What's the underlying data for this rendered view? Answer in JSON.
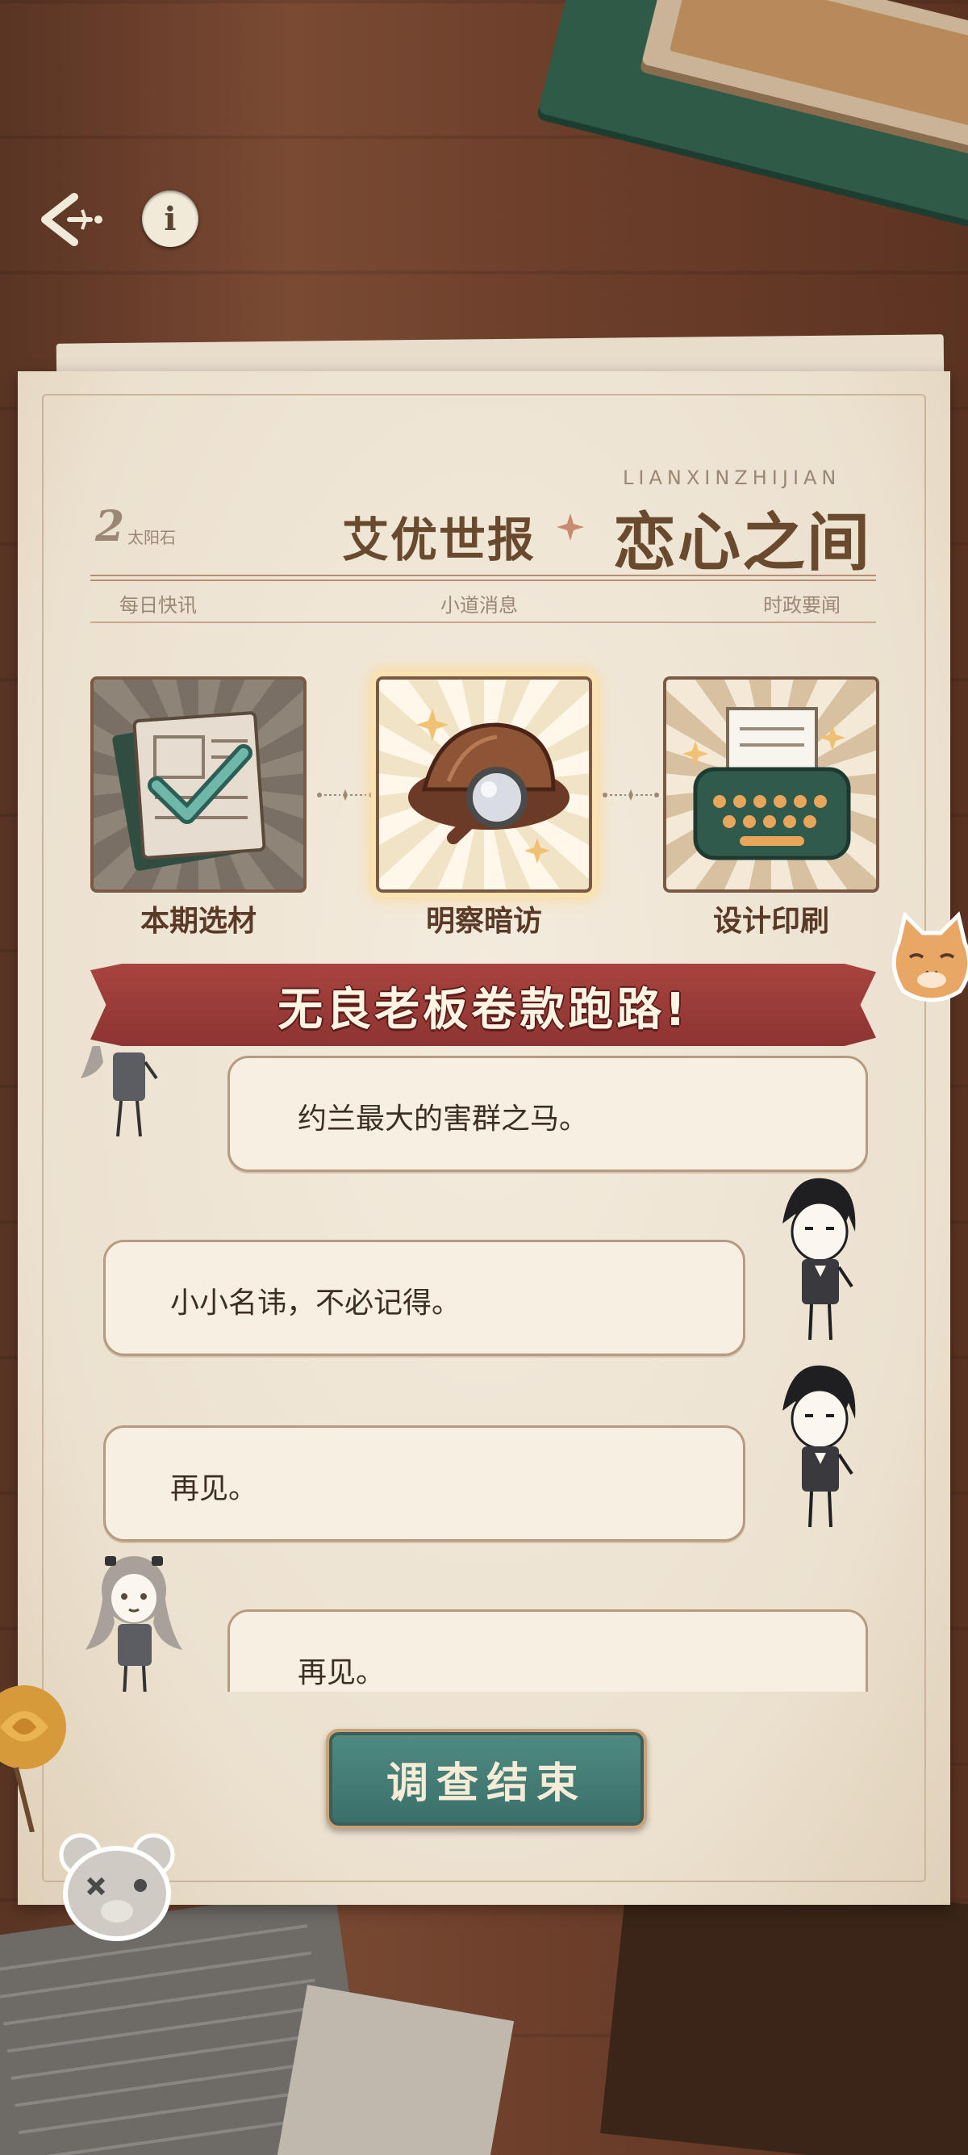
{
  "nav": {
    "back_icon": "back-arrow-icon",
    "info_icon": "info-icon",
    "info_glyph": "i"
  },
  "header": {
    "issue_number": "2",
    "issue_label": "太阳石",
    "paper_name": "艾优世报",
    "title": "恋心之间",
    "title_latin": "LIANXINZHIJIAN",
    "sections": [
      "每日快讯",
      "小道消息",
      "时政要闻"
    ]
  },
  "steps": [
    {
      "label": "本期选材",
      "state": "completed",
      "icon": "documents-check-icon"
    },
    {
      "label": "明察暗访",
      "state": "active",
      "icon": "detective-hat-magnifier-icon"
    },
    {
      "label": "设计印刷",
      "state": "pending",
      "icon": "typewriter-icon"
    }
  ],
  "headline": "无良老板卷款跑路!",
  "dialogue": [
    {
      "speaker": "girl",
      "side": "left",
      "text": "约兰最大的害群之马。"
    },
    {
      "speaker": "boy",
      "side": "right",
      "text": "小小名讳，不必记得。"
    },
    {
      "speaker": "boy",
      "side": "right",
      "text": "再见。"
    },
    {
      "speaker": "girl",
      "side": "left",
      "text": "再见。"
    }
  ],
  "finish_button": "调查结束",
  "colors": {
    "banner": "#a8443f",
    "button": "#4f8b82",
    "paper": "#f3ebdd",
    "ink": "#6a4a2e"
  }
}
